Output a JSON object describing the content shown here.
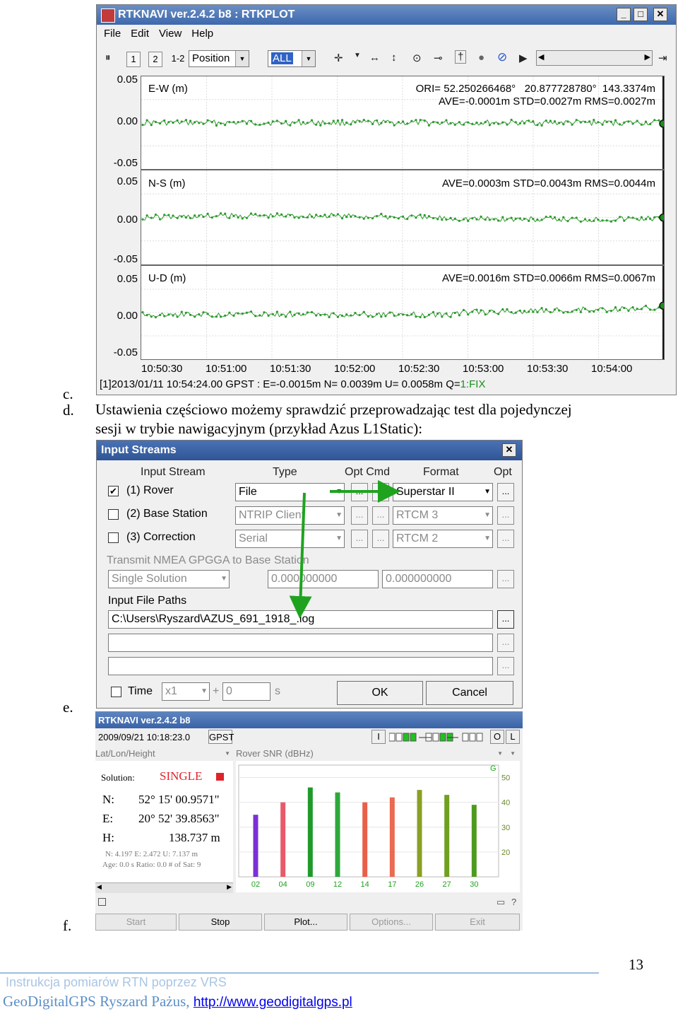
{
  "list": {
    "c": "c.",
    "d": "d.",
    "e": "e.",
    "f": "f."
  },
  "doc_text": {
    "line1": "Ustawienia częściowo możemy sprawdzić przeprowadzając test dla pojedynczej",
    "line2": "sesji w trybie nawigacyjnym (przykład Azus L1Static):"
  },
  "rtkplot": {
    "title": "RTKNAVI ver.2.4.2 b8 : RTKPLOT",
    "caption_buttons": [
      "_",
      "□",
      "✕"
    ],
    "menu": [
      "File",
      "Edit",
      "View",
      "Help"
    ],
    "toolbar": {
      "btn1": "1",
      "btn2": "2",
      "btn12": "1-2",
      "plot_type": "Position",
      "sat_sel": "ALL"
    },
    "y_ticks": {
      "ew": [
        "0.05",
        "0.00",
        "-0.05"
      ],
      "ns": [
        "0.05",
        "0.00",
        "-0.05"
      ],
      "ud": [
        "0.05",
        "0.00",
        "-0.05"
      ]
    },
    "panels": {
      "ew": {
        "label": "E-W (m)",
        "ori": "ORI= 52.250266468°   20.877728780°  143.3374m",
        "stat": "AVE=-0.0001m STD=0.0027m RMS=0.0027m"
      },
      "ns": {
        "label": "N-S (m)",
        "stat": "AVE=0.0003m STD=0.0043m RMS=0.0044m"
      },
      "ud": {
        "label": "U-D (m)",
        "stat": "AVE=0.0016m STD=0.0066m RMS=0.0067m"
      }
    },
    "x_ticks": [
      "10:50:30",
      "10:51:00",
      "10:51:30",
      "10:52:00",
      "10:52:30",
      "10:53:00",
      "10:53:30",
      "10:54:00"
    ],
    "status": "[1]2013/01/11 10:54:24.00 GPST : E=-0.0015m N= 0.0039m U= 0.0058m Q=",
    "status_q": "1:FIX",
    "colors": {
      "series": "#2e9a2e",
      "fix": "#1a8f1a"
    }
  },
  "input_streams": {
    "title": "Input Streams",
    "close": "✕",
    "headers": {
      "stream": "Input Stream",
      "type": "Type",
      "optcmd": "Opt Cmd",
      "format": "Format",
      "opt": "Opt"
    },
    "rows": [
      {
        "checked": "✔",
        "name": "(1) Rover",
        "type": "File",
        "format": "Superstar II"
      },
      {
        "checked": "",
        "name": "(2) Base Station",
        "type": "NTRIP Client",
        "format": "RTCM 3"
      },
      {
        "checked": "",
        "name": "(3) Correction",
        "type": "Serial",
        "format": "RTCM 2"
      }
    ],
    "nmea_label": "Transmit NMEA GPGGA to Base Station",
    "nmea_mode": "Single Solution",
    "nmea_lat": "0.000000000",
    "nmea_lon": "0.000000000",
    "paths_label": "Input File Paths",
    "paths": [
      "C:\\Users\\Ryszard\\AZUS_691_1918_.log",
      "",
      ""
    ],
    "ellipsis": "...",
    "time_label": "Time",
    "time_speed": "x1",
    "time_plus": "+",
    "time_offset": "0",
    "time_unit": "s",
    "ok": "OK",
    "cancel": "Cancel"
  },
  "rtknavi": {
    "title": "RTKNAVI ver.2.4.2 b8",
    "time": "2009/09/21 10:18:23.0",
    "gpst": "GPST",
    "btn_i": "I",
    "btn_o": "O",
    "btn_l": "L",
    "pos_mode": "Lat/Lon/Height",
    "snr_label": "Rover  SNR (dBHz)",
    "snr_sys": "G",
    "solution_label": "Solution:",
    "solution_value": "SINGLE",
    "n_label": "N:",
    "n_value": "52° 15' 00.9571\"",
    "e_label": "E:",
    "e_value": "20° 52' 39.8563\"",
    "h_label": "H:",
    "h_value": "138.737 m",
    "stats1": "N: 4.197 E: 2.472 U: 7.137 m",
    "stats2": "Age: 0.0 s Ratio: 0.0 # of Sat: 9",
    "bottom_buttons": [
      "Start",
      "Stop",
      "Plot...",
      "Options...",
      "Exit"
    ],
    "chart_data": {
      "type": "bar",
      "categories": [
        "02",
        "04",
        "09",
        "12",
        "14",
        "17",
        "26",
        "27",
        "30"
      ],
      "values": [
        35,
        40,
        46,
        44,
        40,
        42,
        45,
        43,
        39
      ],
      "ylabel": "Rover  SNR (dBHz)",
      "y_ticks": [
        20,
        30,
        40,
        50
      ],
      "ylim": [
        10,
        55
      ],
      "colors": [
        "#7b2fd6",
        "#e85a6a",
        "#1f9a2a",
        "#2ea83a",
        "#e8604a",
        "#ea6a52",
        "#8aa024",
        "#6fa020",
        "#4f9a1e"
      ]
    }
  },
  "page_number": "13",
  "footer": {
    "line1": "Instrukcja pomiarów RTN poprzez VRS",
    "line2": "GeoDigitalGPS Ryszard Pażus, ",
    "link": "http://www.geodigitalgps.pl"
  }
}
